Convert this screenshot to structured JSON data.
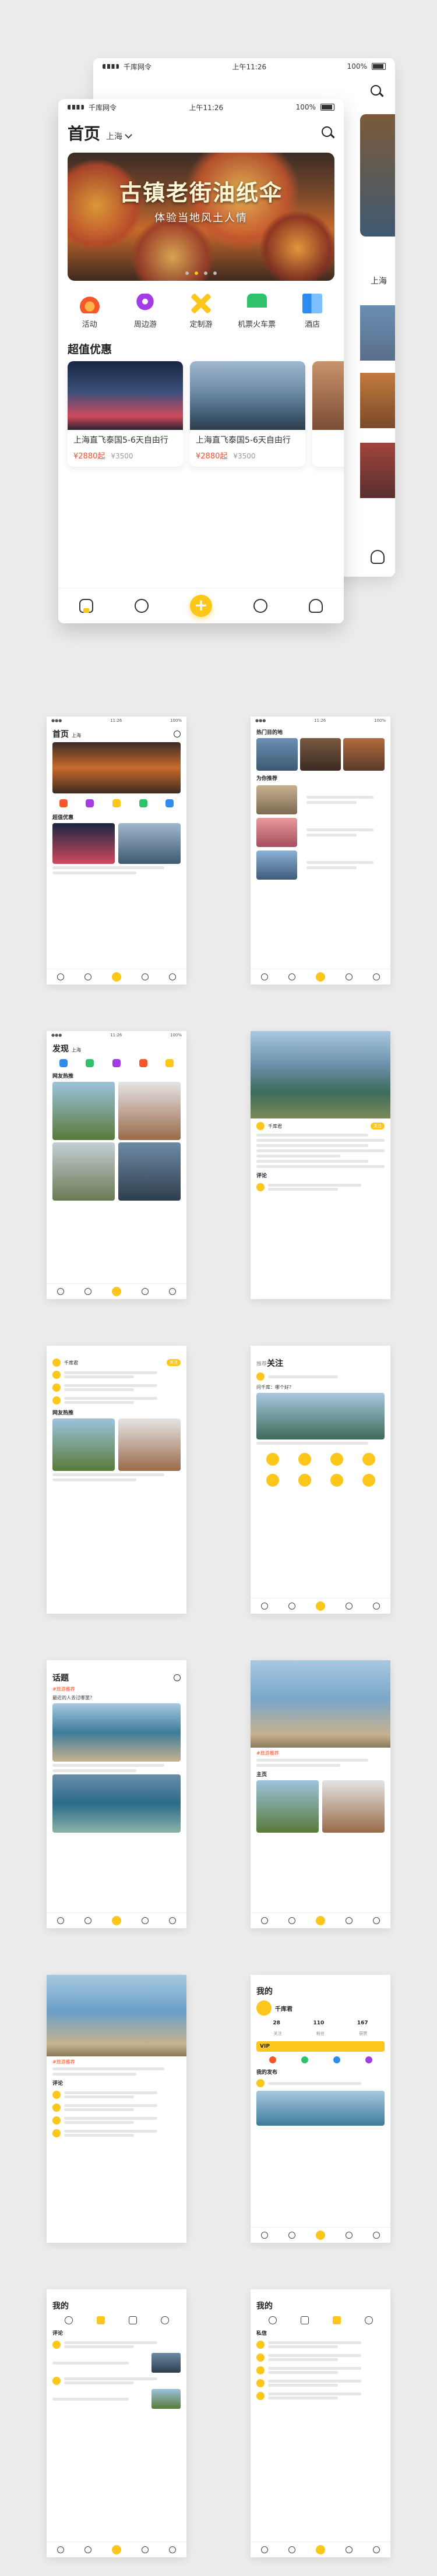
{
  "hero": {
    "back_status": {
      "carrier": "千库网令",
      "time": "上午11:26",
      "battery": "100%"
    },
    "front_status": {
      "carrier": "千库网令",
      "time": "上午11:26",
      "battery": "100%"
    },
    "page_title": "首页",
    "city": "上海",
    "banner": {
      "title": "古镇老街油纸伞",
      "subtitle": "体验当地风土人情"
    },
    "categories": [
      {
        "label": "活动",
        "icon": "flame-icon",
        "color": "#f5572b"
      },
      {
        "label": "周边游",
        "icon": "location-pin-icon",
        "color": "#a23de6"
      },
      {
        "label": "定制游",
        "icon": "pencil-ruler-icon",
        "color": "#fcc61a"
      },
      {
        "label": "机票火车票",
        "icon": "train-icon",
        "color": "#2fc26b"
      },
      {
        "label": "酒店",
        "icon": "building-icon",
        "color": "#2d8cf0"
      }
    ],
    "section_title": "超值优惠",
    "deals": [
      {
        "title": "上海直飞泰国5-6天自由行",
        "price": "¥2880起",
        "old": "¥3500"
      },
      {
        "title": "上海直飞泰国5-6天自由行",
        "price": "¥2880起",
        "old": "¥3500"
      }
    ],
    "back_city": "上海"
  },
  "screens": {
    "home": {
      "title": "首页",
      "city": "上海",
      "section": "超值优惠"
    },
    "hot": {
      "title": "热门目的地",
      "section": "为你推荐"
    },
    "discover": {
      "title": "发现",
      "city": "上海",
      "section": "网友热推"
    },
    "detail": {
      "user": "千库君",
      "tag": "关注",
      "comments": "评论"
    },
    "comments": {
      "user": "千库君",
      "tag": "关注",
      "section": "网友热推"
    },
    "follow": {
      "tab_a": "推荐",
      "tab_b": "关注",
      "question": "问千库：哪个好？"
    },
    "topic": {
      "title": "话题",
      "topic_tag": "#旅游推荐",
      "desc": "最近的人去过哪里？"
    },
    "topic_detail": {
      "topic_tag": "#旅游推荐",
      "section": "主页"
    },
    "topic_comments": {
      "topic_tag": "#旅游推荐",
      "section": "评论"
    },
    "profile": {
      "title": "我的",
      "user": "千库君",
      "stats": [
        "28",
        "110",
        "167"
      ],
      "stat_labels": [
        "关注",
        "粉丝",
        "获赞"
      ],
      "vip": "VIP",
      "section": "我的发布"
    },
    "mine_comments": {
      "title": "我的",
      "section": "评论"
    },
    "mine_messages": {
      "title": "我的",
      "section": "私信"
    }
  }
}
